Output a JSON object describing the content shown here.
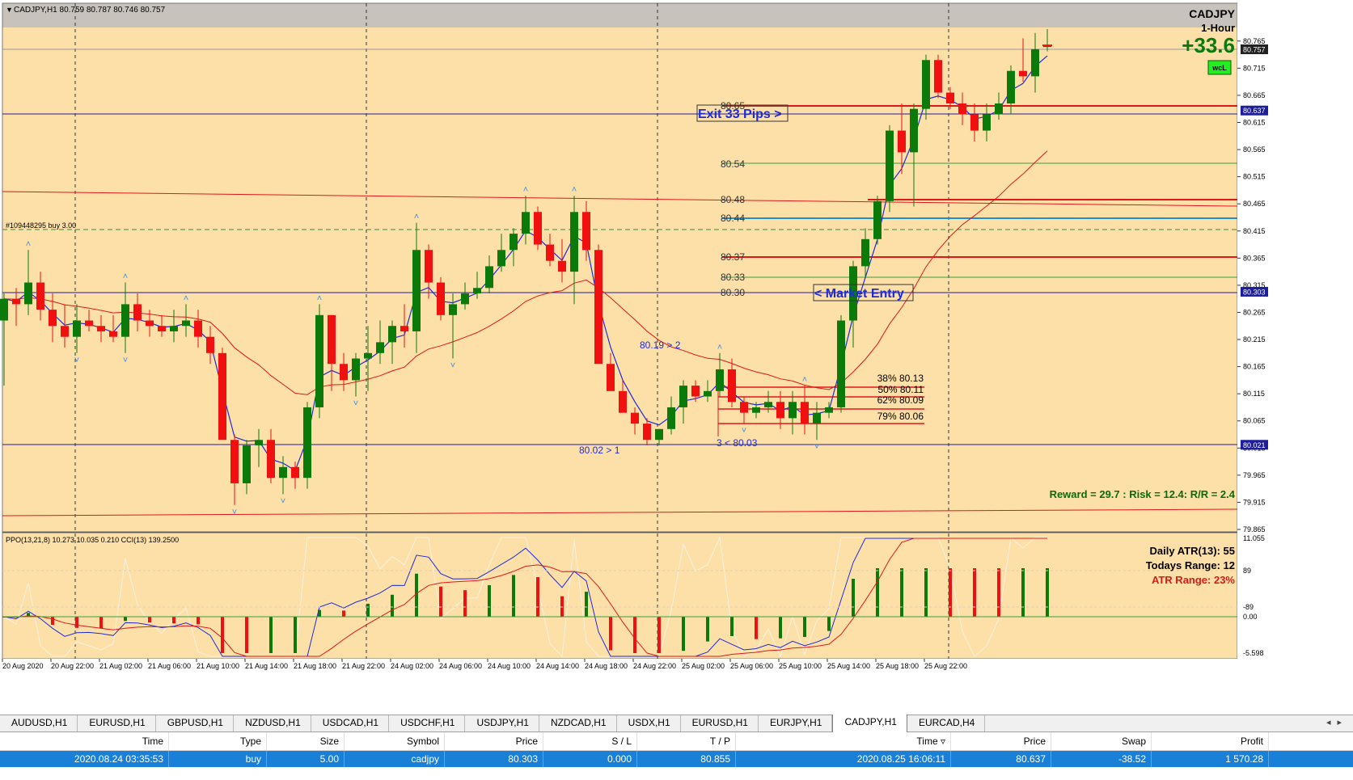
{
  "chart_header": {
    "symbol_info": "CADJPY,H1  80.759 80.787 80.746 80.757"
  },
  "symbol_box": {
    "symbol": "CADJPY",
    "timeframe": "1-Hour",
    "pips": "+33.6",
    "badge": "wcL"
  },
  "order_label": "#109448295 buy 3.00",
  "annotations": {
    "exit": "Exit 33 Pips >",
    "market_entry": "< Market Entry",
    "price_80_65": "80.65",
    "price_80_54": "80.54",
    "price_80_48": "80.48",
    "price_80_44": "80.44",
    "price_80_37": "80.37",
    "price_80_33": "80.33",
    "price_80_30": "80.30",
    "swing_high": "80.19 > 2",
    "swing_low": "80.02 > 1",
    "swing_low2": "3 < 80.03",
    "fib_38": "38% 80.13",
    "fib_50": "50% 80.11",
    "fib_62": "62% 80.09",
    "fib_79": "79% 80.06",
    "reward_risk": "Reward = 29.7 : Risk = 12.4: R/R = 2.4"
  },
  "price_axis": {
    "ticks": [
      "80.765",
      "80.715",
      "80.665",
      "80.615",
      "80.565",
      "80.515",
      "80.465",
      "80.415",
      "80.365",
      "80.315",
      "80.265",
      "80.215",
      "80.165",
      "80.115",
      "80.065",
      "80.015",
      "79.965",
      "79.915",
      "79.865"
    ],
    "current_price": "80.757",
    "level_labels": [
      "80.637",
      "80.303",
      "80.021"
    ],
    "level_colors": [
      "#1e1e9c",
      "#1e1e9c",
      "#1e1e9c"
    ]
  },
  "indicator": {
    "header": "PPO(13,21,8) 10.273 10.035 0.210  CCI(13) 139.2500",
    "atr_label": "Daily ATR(13): 55",
    "range_label": "Todays Range: 12",
    "atr_range_label": "ATR Range: 23%",
    "axis_ticks": [
      "11.055",
      "89",
      "-89",
      "0.00",
      "-5.598"
    ]
  },
  "time_axis": [
    "20 Aug 2020",
    "20 Aug 22:00",
    "21 Aug 02:00",
    "21 Aug 06:00",
    "21 Aug 10:00",
    "21 Aug 14:00",
    "21 Aug 18:00",
    "21 Aug 22:00",
    "24 Aug 02:00",
    "24 Aug 06:00",
    "24 Aug 10:00",
    "24 Aug 14:00",
    "24 Aug 18:00",
    "24 Aug 22:00",
    "25 Aug 02:00",
    "25 Aug 06:00",
    "25 Aug 10:00",
    "25 Aug 14:00",
    "25 Aug 18:00",
    "25 Aug 22:00"
  ],
  "tabs": [
    "AUDUSD,H1",
    "EURUSD,H1",
    "GBPUSD,H1",
    "NZDUSD,H1",
    "USDCAD,H1",
    "USDCHF,H1",
    "USDJPY,H1",
    "NZDCAD,H1",
    "USDX,H1",
    "EURUSD,H1",
    "EURJPY,H1",
    "CADJPY,H1",
    "EURCAD,H4"
  ],
  "active_tab": "CADJPY,H1",
  "terminal": {
    "headers": [
      "Time",
      "Type",
      "Size",
      "Symbol",
      "Price",
      "S / L",
      "T / P",
      "Time",
      "Price",
      "Swap",
      "Profit"
    ],
    "row": [
      "2020.08.24 03:35:53",
      "buy",
      "5.00",
      "cadjpy",
      "80.303",
      "0.000",
      "80.855",
      "2020.08.25 16:06:11",
      "80.637",
      "-38.52",
      "1 570.28"
    ]
  },
  "colors": {
    "background": "#fde0a8",
    "bull": "#0b7a0b",
    "bear": "#f01010",
    "fast_ma": "#1e2bd8",
    "slow_ma": "#e01818",
    "level_blue": "#1e1e9c",
    "level_red": "#e01818",
    "level_green": "#3aa03a"
  },
  "chart_data": {
    "type": "candlestick",
    "ohlc": [
      [
        80.25,
        80.3,
        80.13,
        80.29
      ],
      [
        80.29,
        80.31,
        80.24,
        80.28
      ],
      [
        80.28,
        80.38,
        80.26,
        80.32
      ],
      [
        80.32,
        80.34,
        80.25,
        80.27
      ],
      [
        80.27,
        80.3,
        80.21,
        80.24
      ],
      [
        80.24,
        80.28,
        80.2,
        80.22
      ],
      [
        80.22,
        80.28,
        80.19,
        80.25
      ],
      [
        80.25,
        80.27,
        80.23,
        80.24
      ],
      [
        80.24,
        80.26,
        80.21,
        80.23
      ],
      [
        80.23,
        80.26,
        80.21,
        80.22
      ],
      [
        80.22,
        80.32,
        80.19,
        80.28
      ],
      [
        80.28,
        80.3,
        80.23,
        80.25
      ],
      [
        80.25,
        80.27,
        80.22,
        80.24
      ],
      [
        80.24,
        80.26,
        80.22,
        80.23
      ],
      [
        80.23,
        80.27,
        80.21,
        80.24
      ],
      [
        80.24,
        80.28,
        80.22,
        80.25
      ],
      [
        80.25,
        80.27,
        80.2,
        80.22
      ],
      [
        80.22,
        80.24,
        80.17,
        80.19
      ],
      [
        80.19,
        80.2,
        80.04,
        80.03
      ],
      [
        80.03,
        80.04,
        79.91,
        79.95
      ],
      [
        79.95,
        80.03,
        79.93,
        80.02
      ],
      [
        80.02,
        80.05,
        79.98,
        80.03
      ],
      [
        80.03,
        80.05,
        79.95,
        79.96
      ],
      [
        79.96,
        80.0,
        79.93,
        79.98
      ],
      [
        79.98,
        79.99,
        79.94,
        79.96
      ],
      [
        79.96,
        80.1,
        79.94,
        80.09
      ],
      [
        80.09,
        80.28,
        80.07,
        80.26
      ],
      [
        80.26,
        80.26,
        80.12,
        80.17
      ],
      [
        80.17,
        80.19,
        80.12,
        80.14
      ],
      [
        80.14,
        80.19,
        80.11,
        80.18
      ],
      [
        80.18,
        80.24,
        80.12,
        80.19
      ],
      [
        80.19,
        80.25,
        80.17,
        80.21
      ],
      [
        80.21,
        80.25,
        80.17,
        80.24
      ],
      [
        80.24,
        80.28,
        80.2,
        80.23
      ],
      [
        80.23,
        80.43,
        80.19,
        80.38
      ],
      [
        80.38,
        80.39,
        80.29,
        80.32
      ],
      [
        80.32,
        80.33,
        80.25,
        80.26
      ],
      [
        80.26,
        80.3,
        80.18,
        80.28
      ],
      [
        80.28,
        80.32,
        80.27,
        80.3
      ],
      [
        80.3,
        80.34,
        80.29,
        80.31
      ],
      [
        80.31,
        80.37,
        80.3,
        80.35
      ],
      [
        80.35,
        80.41,
        80.34,
        80.38
      ],
      [
        80.38,
        80.42,
        80.35,
        80.41
      ],
      [
        80.41,
        80.48,
        80.39,
        80.45
      ],
      [
        80.45,
        80.46,
        80.38,
        80.39
      ],
      [
        80.39,
        80.41,
        80.35,
        80.36
      ],
      [
        80.36,
        80.4,
        80.32,
        80.34
      ],
      [
        80.34,
        80.48,
        80.28,
        80.45
      ],
      [
        80.45,
        80.47,
        80.36,
        80.38
      ],
      [
        80.38,
        80.39,
        80.21,
        80.17
      ],
      [
        80.17,
        80.19,
        80.12,
        80.12
      ],
      [
        80.12,
        80.14,
        80.08,
        80.08
      ],
      [
        80.08,
        80.09,
        80.04,
        80.06
      ],
      [
        80.06,
        80.07,
        80.02,
        80.03
      ],
      [
        80.03,
        80.05,
        80.02,
        80.05
      ],
      [
        80.05,
        80.11,
        80.04,
        80.09
      ],
      [
        80.09,
        80.14,
        80.06,
        80.13
      ],
      [
        80.13,
        80.14,
        80.1,
        80.11
      ],
      [
        80.11,
        80.14,
        80.1,
        80.12
      ],
      [
        80.12,
        80.19,
        80.11,
        80.16
      ],
      [
        80.16,
        80.18,
        80.09,
        80.1
      ],
      [
        80.1,
        80.11,
        80.06,
        80.08
      ],
      [
        80.08,
        80.1,
        80.07,
        80.09
      ],
      [
        80.09,
        80.12,
        80.08,
        80.1
      ],
      [
        80.1,
        80.12,
        80.05,
        80.07
      ],
      [
        80.07,
        80.12,
        80.04,
        80.1
      ],
      [
        80.1,
        80.13,
        80.04,
        80.06
      ],
      [
        80.06,
        80.1,
        80.03,
        80.08
      ],
      [
        80.08,
        80.1,
        80.07,
        80.09
      ],
      [
        80.09,
        80.26,
        80.08,
        80.25
      ],
      [
        80.25,
        80.36,
        80.2,
        80.35
      ],
      [
        80.35,
        80.42,
        80.33,
        80.4
      ],
      [
        80.4,
        80.48,
        80.39,
        80.47
      ],
      [
        80.47,
        80.61,
        80.45,
        80.6
      ],
      [
        80.6,
        80.65,
        80.52,
        80.56
      ],
      [
        80.56,
        80.65,
        80.46,
        80.64
      ],
      [
        80.64,
        80.74,
        80.62,
        80.73
      ],
      [
        80.73,
        80.74,
        80.66,
        80.67
      ],
      [
        80.67,
        80.68,
        80.64,
        80.65
      ],
      [
        80.65,
        80.67,
        80.61,
        80.63
      ],
      [
        80.63,
        80.65,
        80.58,
        80.6
      ],
      [
        80.6,
        80.65,
        80.58,
        80.63
      ],
      [
        80.63,
        80.67,
        80.62,
        80.65
      ],
      [
        80.65,
        80.72,
        80.63,
        80.71
      ],
      [
        80.71,
        80.77,
        80.69,
        80.7
      ],
      [
        80.7,
        80.78,
        80.67,
        80.75
      ],
      [
        80.757,
        80.787,
        80.746,
        80.757
      ]
    ],
    "levels": [
      80.637,
      80.303,
      80.021
    ],
    "price_range": [
      79.865,
      80.79
    ],
    "indicator_range": [
      -5.598,
      11.055
    ]
  }
}
